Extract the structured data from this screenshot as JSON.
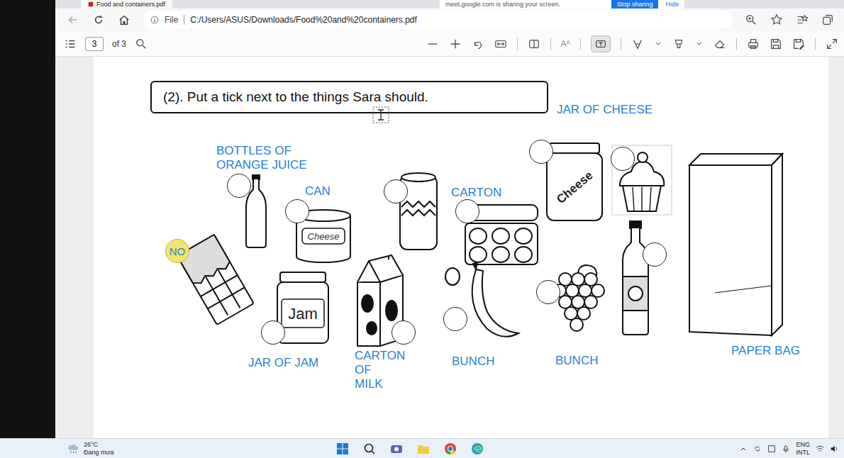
{
  "browser": {
    "tab_title": "Food and containers.pdf",
    "address_prefix": "File",
    "address": "C:/Users/ASUS/Downloads/Food%20and%20containers.pdf"
  },
  "share_banner": {
    "text": "meet.google.com is sharing your screen.",
    "buttons": [
      "Stop sharing",
      "Hide"
    ]
  },
  "pdf_toolbar": {
    "page": "3",
    "page_count": "of 3",
    "text_view": "Aᴬ",
    "read_aloud_selected": true
  },
  "worksheet": {
    "title": "(2). Put a tick next to the things Sara should.",
    "labels": [
      {
        "lines": [
          "JAR OF CHEESE"
        ]
      },
      {
        "lines": [
          "BOTTLES OF",
          "ORANGE JUICE"
        ]
      },
      {
        "lines": [
          "CAN"
        ]
      },
      {
        "lines": [
          "CARTON"
        ]
      },
      {
        "lines": [
          "JAR OF JAM"
        ]
      },
      {
        "lines": [
          "CARTON",
          "OF",
          "MILK"
        ]
      },
      {
        "lines": [
          "BUNCH"
        ]
      },
      {
        "lines": [
          "BUNCH"
        ]
      },
      {
        "lines": [
          "PAPER BAG"
        ]
      }
    ],
    "pictures": [
      {
        "kind": "bottle",
        "print": "",
        "answer": "",
        "highlighted": false
      },
      {
        "kind": "tin",
        "print": "Cheese",
        "answer": "",
        "highlighted": false
      },
      {
        "kind": "soda-can",
        "print": "",
        "answer": "",
        "highlighted": false
      },
      {
        "kind": "eggs",
        "print": "",
        "answer": "",
        "highlighted": false
      },
      {
        "kind": "cheese-jar",
        "print": "Cheese",
        "answer": "",
        "highlighted": false
      },
      {
        "kind": "cupcake",
        "print": "",
        "answer": "",
        "highlighted": false
      },
      {
        "kind": "chocolate",
        "print": "",
        "answer": "NO",
        "highlighted": true
      },
      {
        "kind": "jam-jar",
        "print": "Jam",
        "answer": "",
        "highlighted": false
      },
      {
        "kind": "milk",
        "print": "",
        "answer": "",
        "highlighted": false
      },
      {
        "kind": "banana",
        "print": "",
        "answer": "",
        "highlighted": false
      },
      {
        "kind": "grapes",
        "print": "",
        "answer": "",
        "highlighted": false
      },
      {
        "kind": "soda-bottle",
        "print": "",
        "answer": "",
        "highlighted": false
      },
      {
        "kind": "paper-bag",
        "print": "",
        "answer": null,
        "highlighted": false
      }
    ]
  },
  "taskbar": {
    "temperature": "26°C",
    "weather": "Đang mưa",
    "language": "ENG",
    "layout": "INTL"
  }
}
